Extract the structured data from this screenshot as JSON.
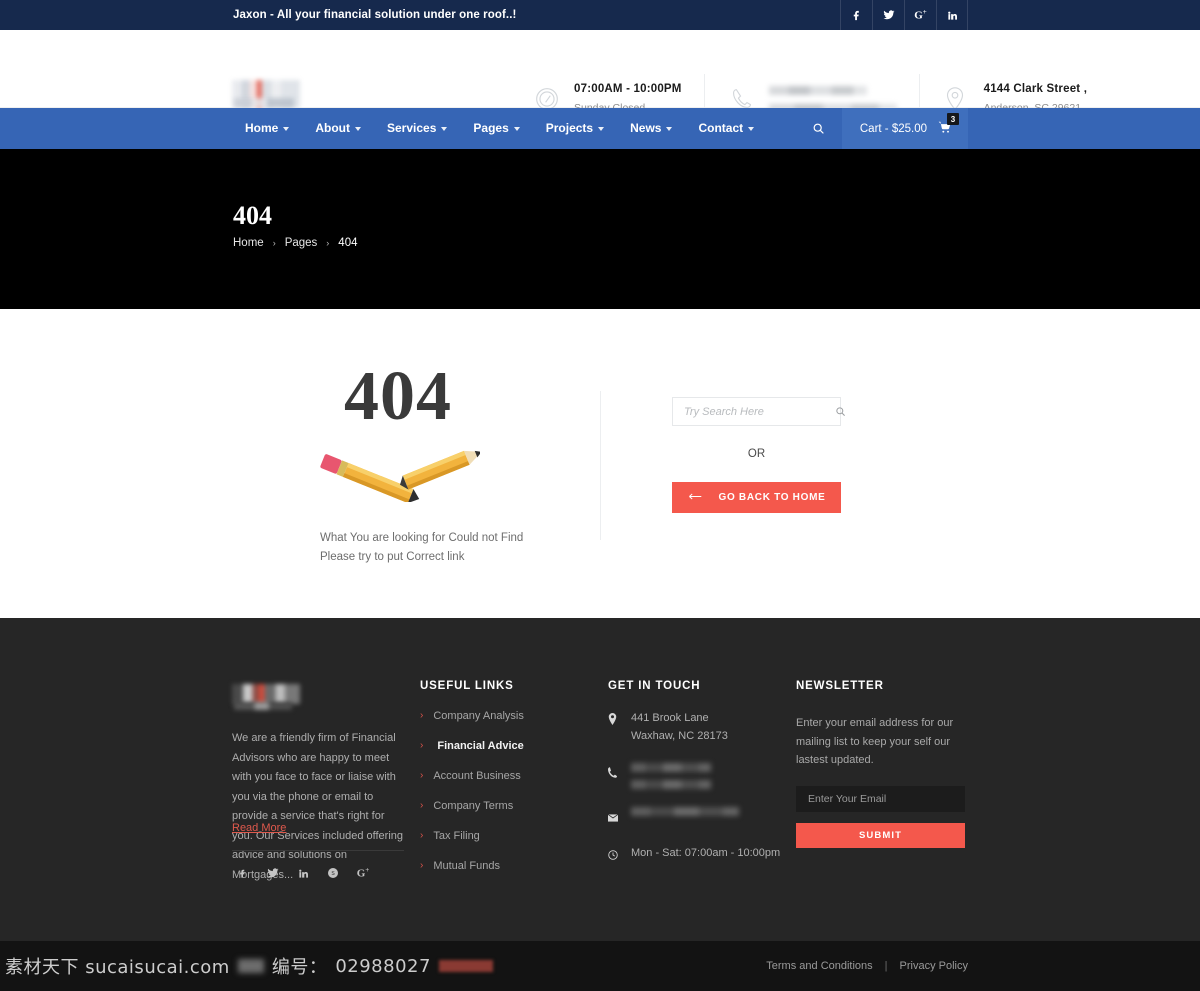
{
  "topbar": {
    "tagline": "Jaxon - All your financial solution under one roof..!",
    "social": [
      {
        "name": "facebook-icon",
        "label": "f"
      },
      {
        "name": "twitter-icon",
        "label": "t"
      },
      {
        "name": "google-plus-icon",
        "label": "G+"
      },
      {
        "name": "linkedin-icon",
        "label": "in"
      }
    ]
  },
  "header": {
    "logo_alt": "Jaxon logo",
    "info": [
      {
        "icon": "clock-icon",
        "line1": "07:00AM - 10:00PM",
        "line2": "Sunday Closed",
        "blurred": false
      },
      {
        "icon": "phone-icon",
        "line1": "",
        "line2": "",
        "blurred": true
      },
      {
        "icon": "location-pin-icon",
        "line1": "4144 Clark Street ,",
        "line2": "Anderson, SC 29621",
        "blurred": false
      }
    ]
  },
  "nav": {
    "items": [
      {
        "label": "Home",
        "has_dropdown": true
      },
      {
        "label": "About",
        "has_dropdown": true
      },
      {
        "label": "Services",
        "has_dropdown": true
      },
      {
        "label": "Pages",
        "has_dropdown": true
      },
      {
        "label": "Projects",
        "has_dropdown": true
      },
      {
        "label": "News",
        "has_dropdown": true
      },
      {
        "label": "Contact",
        "has_dropdown": true
      }
    ],
    "cart_label": "Cart - $25.00",
    "cart_count": "3",
    "accent_color": "#3665b5"
  },
  "hero": {
    "title": "404",
    "breadcrumb": [
      {
        "label": "Home"
      },
      {
        "label": "Pages"
      },
      {
        "label": "404"
      }
    ],
    "separator": "›",
    "background_color": "#000000"
  },
  "main": {
    "error_code": "404",
    "message_line1": "What You are looking for Could not Find",
    "message_line2": "Please try to put Correct link",
    "search_placeholder": "Try Search Here",
    "search_value": "",
    "or_label": "OR",
    "home_button_label": "GO BACK TO HOME",
    "button_color": "#f4584c"
  },
  "footer": {
    "about_text": "We are a friendly firm of Financial Advisors who are happy to meet with you face to face or liaise with you via the phone or email to provide a service that's right for you. Our Services included offering advice and solutions on Mortgages...",
    "read_more": "Read More",
    "social": [
      {
        "name": "facebook-icon",
        "label": "f"
      },
      {
        "name": "twitter-icon",
        "label": "t"
      },
      {
        "name": "linkedin-icon",
        "label": "in"
      },
      {
        "name": "skype-icon",
        "label": "S"
      },
      {
        "name": "google-plus-icon",
        "label": "G+"
      }
    ],
    "useful_links": {
      "title": "USEFUL LINKS",
      "items": [
        {
          "label": "Company Analysis",
          "active": false
        },
        {
          "label": "Financial Advice",
          "active": true
        },
        {
          "label": "Account Business",
          "active": false
        },
        {
          "label": "Company Terms",
          "active": false
        },
        {
          "label": "Tax Filing",
          "active": false
        },
        {
          "label": "Mutual Funds",
          "active": false
        }
      ]
    },
    "get_in_touch": {
      "title": "GET IN TOUCH",
      "address_line1": "441 Brook Lane",
      "address_line2": "Waxhaw, NC 28173",
      "phone_blurred": true,
      "email_blurred": true,
      "hours": "Mon - Sat: 07:00am - 10:00pm"
    },
    "newsletter": {
      "title": "NEWSLETTER",
      "description": "Enter your email address for our mailing list to keep your self our lastest updated.",
      "email_placeholder": "Enter Your Email",
      "email_value": "",
      "submit_label": "SUBMIT"
    },
    "background_color": "#262626"
  },
  "bottombar": {
    "terms_label": "Terms and Conditions",
    "pipe": "|",
    "privacy_label": "Privacy Policy"
  },
  "watermark": {
    "site": "素材天下 sucaisucai.com",
    "id_label": "编号：",
    "id_value": "02988027"
  }
}
